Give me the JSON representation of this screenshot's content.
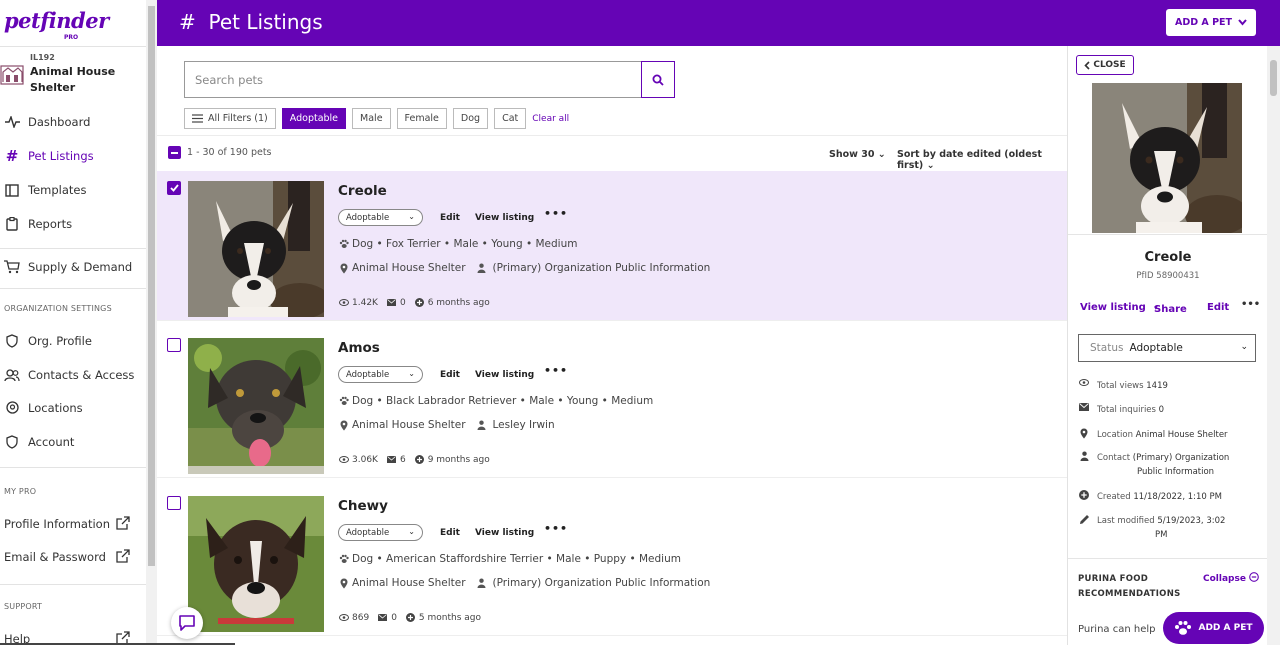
{
  "brand": {
    "logo": "petfinder",
    "logo_sub": "PRO"
  },
  "org": {
    "id": "IL192",
    "name_line1": "Animal House",
    "name_line2": "Shelter"
  },
  "nav": {
    "dashboard": "Dashboard",
    "pet_listings": "Pet Listings",
    "templates": "Templates",
    "reports": "Reports",
    "supply": "Supply & Demand",
    "section_org": "ORGANIZATION SETTINGS",
    "org_profile": "Org. Profile",
    "contacts": "Contacts & Access",
    "locations": "Locations",
    "account": "Account",
    "section_mypro": "MY PRO",
    "profile_info": "Profile Information",
    "email_password": "Email & Password",
    "section_support": "SUPPORT",
    "help": "Help"
  },
  "header": {
    "title": "#  Pet Listings",
    "add_pet": "ADD A PET"
  },
  "search": {
    "placeholder": "Search pets"
  },
  "filters": {
    "all": "All Filters (1)",
    "adoptable": "Adoptable",
    "male": "Male",
    "female": "Female",
    "dog": "Dog",
    "cat": "Cat",
    "clear": "Clear all"
  },
  "list": {
    "count": "1 - 30 of 190 pets",
    "show": "Show 30",
    "sort": "Sort by date edited (oldest first)",
    "edit": "Edit",
    "view": "View listing",
    "more": "•••",
    "pets": [
      {
        "name": "Creole",
        "status": "Adoptable",
        "desc": "Dog • Fox Terrier • Male • Young • Medium",
        "location": "Animal House Shelter",
        "contact": "(Primary) Organization Public Information",
        "views": "1.42K",
        "inquiries": "0",
        "age": "6 months ago"
      },
      {
        "name": "Amos",
        "status": "Adoptable",
        "desc": "Dog • Black Labrador Retriever • Male • Young • Medium",
        "location": "Animal House Shelter",
        "contact": "Lesley Irwin",
        "views": "3.06K",
        "inquiries": "6",
        "age": "9 months ago"
      },
      {
        "name": "Chewy",
        "status": "Adoptable",
        "desc": "Dog • American Staffordshire Terrier • Male • Puppy • Medium",
        "location": "Animal House Shelter",
        "contact": "(Primary) Organization Public Information",
        "views": "869",
        "inquiries": "0",
        "age": "5 months ago"
      }
    ]
  },
  "panel": {
    "close": "CLOSE",
    "name": "Creole",
    "pfid": "PfID 58900431",
    "view": "View listing",
    "share": "Share",
    "edit": "Edit",
    "more": "•••",
    "status_label": "Status",
    "status_value": "Adoptable",
    "views_label": "Total views",
    "views_value": "1419",
    "inq_label": "Total inquiries",
    "inq_value": "0",
    "loc_label": "Location",
    "loc_value": "Animal House Shelter",
    "contact_label": "Contact",
    "contact_value1": "(Primary) Organization",
    "contact_value2": "Public Information",
    "created_label": "Created",
    "created_value": "11/18/2022, 1:10 PM",
    "modified_label": "Last modified",
    "modified_value1": "5/19/2023, 3:02",
    "modified_value2": "PM",
    "purina_title1": "PURINA FOOD",
    "purina_title2": "RECOMMENDATIONS",
    "collapse": "Collapse",
    "purina_text": "Purina can help"
  },
  "fab": {
    "label": "ADD A PET"
  },
  "colors": {
    "brand": "#6504b5",
    "selected_row": "#f0e7fa"
  }
}
